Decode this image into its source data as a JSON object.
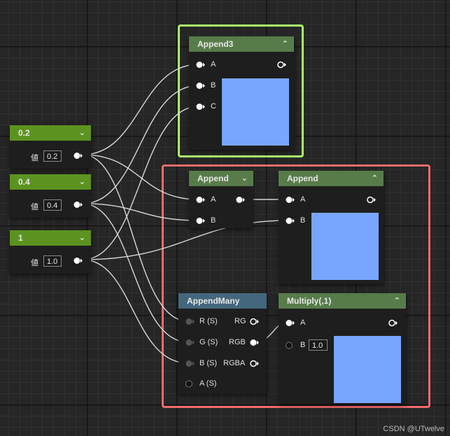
{
  "colors": {
    "preview": "#78a6ff",
    "frame_green": "#a9f56c",
    "frame_red": "#f26b6b"
  },
  "const1": {
    "title": "0.2",
    "value_label": "値",
    "value": "0.2",
    "collapse_icon": "chevron-down-icon"
  },
  "const2": {
    "title": "0.4",
    "value_label": "値",
    "value": "0.4",
    "collapse_icon": "chevron-down-icon"
  },
  "const3": {
    "title": "1",
    "value_label": "値",
    "value": "1.0",
    "collapse_icon": "chevron-down-icon"
  },
  "append3": {
    "title": "Append3",
    "inputs": [
      "A",
      "B",
      "C"
    ],
    "collapse_icon": "chevron-up-icon"
  },
  "append_small": {
    "title": "Append",
    "inputs": [
      "A",
      "B"
    ],
    "collapse_icon": "chevron-down-icon"
  },
  "append_large": {
    "title": "Append",
    "inputs": [
      "A",
      "B"
    ]
  },
  "append_many": {
    "title": "AppendMany",
    "inputs": [
      "R (S)",
      "G (S)",
      "B (S)",
      "A (S)"
    ],
    "outputs": [
      "RG",
      "RGB",
      "RGBA"
    ]
  },
  "multiply": {
    "title": "Multiply(,1)",
    "inputs": [
      "A",
      "B"
    ],
    "b_value": "1.0",
    "collapse_icon": "chevron-up-icon"
  },
  "watermark": "CSDN @UTwelve"
}
